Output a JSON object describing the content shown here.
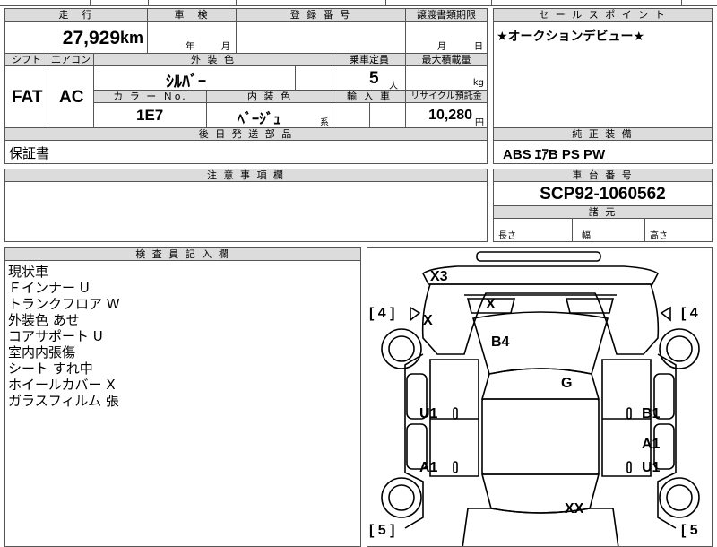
{
  "vehicle": {
    "mileage_header": "走　行",
    "mileage_value": "27,929",
    "mileage_unit": "km",
    "inspection_header": "車　検",
    "inspection_year": "年",
    "inspection_month": "月",
    "registration_header": "登 録 番 号",
    "transfer_header": "譲渡書類期限",
    "transfer_month": "月",
    "transfer_day": "日",
    "shift_header": "シフト",
    "shift_value": "FAT",
    "aircon_header": "エアコン",
    "aircon_value": "AC",
    "exterior_color_header": "外 装 色",
    "exterior_color_value": "ｼﾙﾊﾞｰ",
    "capacity_header": "乗車定員",
    "capacity_value": "5",
    "capacity_unit": "人",
    "max_load_header": "最大積載量",
    "max_load_unit": "kg",
    "color_no_header": "カ ラ ー Ｎo.",
    "color_no_value": "1E7",
    "interior_color_header": "内 装 色",
    "interior_color_value": "ﾍﾞｰｼﾞｭ",
    "interior_color_suffix": "系",
    "import_header": "輸 入 車",
    "recycle_header": "リサイクル預託金",
    "recycle_value": "10,280",
    "recycle_unit": "円"
  },
  "sales_point": {
    "header": "セ ー ル ス ポ イ ン ト",
    "text": "★オークションデビュー★"
  },
  "shipping_parts": {
    "header": "後 日 発 送 部 品",
    "text": "保証書"
  },
  "equipment": {
    "header": "純 正 装 備",
    "text": "ABS ｴｱB PS PW"
  },
  "caution": {
    "header": "注 意 事 項 欄"
  },
  "chassis": {
    "header": "車 台 番 号",
    "value": "SCP92-1060562"
  },
  "specs": {
    "header": "諸 元",
    "length": "長さ",
    "width": "幅",
    "height": "高さ"
  },
  "inspector": {
    "header": "検 査 員 記 入 欄",
    "notes": [
      "現状車",
      "Ｆインナー U",
      "トランクフロア W",
      "外装色 あせ",
      "コアサポート U",
      "室内内張傷",
      "シート すれ中",
      "ホイールカバー X",
      "ガラスフィルム 張"
    ]
  },
  "diagram": {
    "marks": {
      "x3": "X3",
      "x_front_left": "X",
      "x_hood": "X",
      "b4": "B4",
      "g": "G",
      "u1_left": "U1",
      "b1_right": "B1",
      "a1_right": "A1",
      "u1_right": "U1",
      "a1_left": "A1",
      "xx": "XX"
    },
    "tire_front_left": "4",
    "tire_front_right": "4",
    "tire_rear_left": "5",
    "tire_rear_right": "5"
  }
}
